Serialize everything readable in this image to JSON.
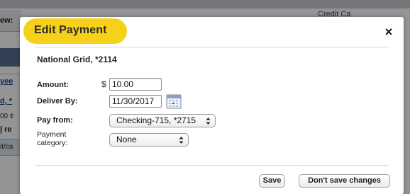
{
  "background": {
    "fragments": [
      "ew:",
      "yee",
      "d, *",
      "00 ¢",
      "| re",
      "it/ca"
    ],
    "right_text": "Credit Ca"
  },
  "modal": {
    "title": "Edit Payment",
    "close_glyph": "×",
    "payee": "National Grid, *2114",
    "amount": {
      "label": "Amount:",
      "currency_symbol": "$",
      "value": "10.00"
    },
    "deliver_by": {
      "label": "Deliver By:",
      "value": "11/30/2017",
      "icon": "calendar-icon"
    },
    "pay_from": {
      "label": "Pay from:",
      "selected": "Checking-715, *2715"
    },
    "payment_category": {
      "label_line1": "Payment",
      "label_line2": "category:",
      "selected": "None"
    },
    "buttons": {
      "save": "Save",
      "dont_save": "Don't save changes"
    }
  },
  "colors": {
    "title_pill": "#f6d11b",
    "overlay": "rgba(0,0,0,0.42)"
  }
}
